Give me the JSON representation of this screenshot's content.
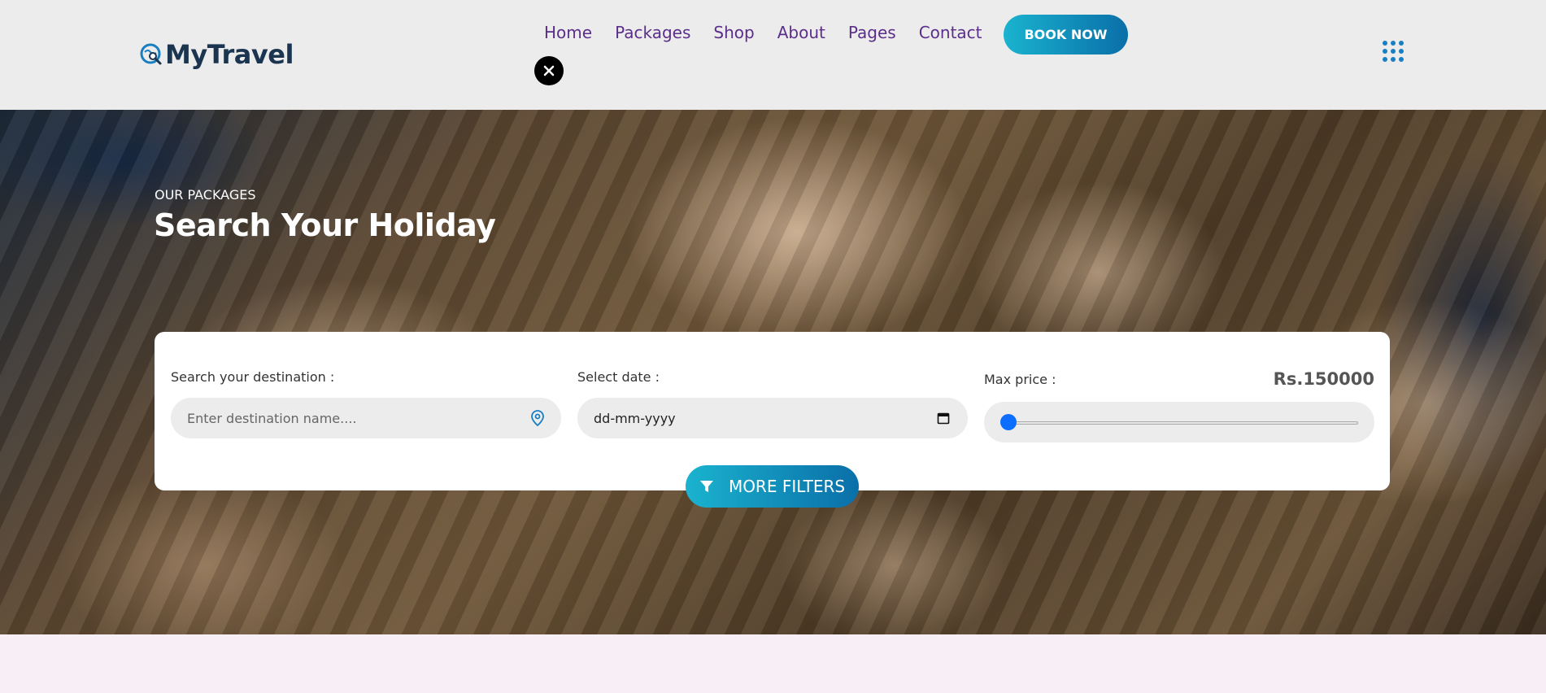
{
  "header": {
    "logo_text": "MyTravel",
    "nav": [
      "Home",
      "Packages",
      "Shop",
      "About",
      "Pages",
      "Contact"
    ],
    "book_label": "BOOK NOW"
  },
  "hero": {
    "eyebrow": "OUR PACKAGES",
    "title": "Search Your Holiday"
  },
  "search": {
    "destination_label": "Search your destination :",
    "destination_placeholder": "Enter destination name....",
    "date_label": "Select date :",
    "date_value": "dd-mm-yyyy",
    "price_label": "Max price :",
    "price_value": "Rs.150000",
    "price_slider_fraction": 0.0,
    "filters_label": "MORE FILTERS"
  },
  "colors": {
    "accent_start": "#1ab3cf",
    "accent_end": "#0a6fa8",
    "nav_text": "#5a2e8a",
    "logo_text": "#1b3550"
  },
  "icons": {
    "logo": "globe-search-icon",
    "close": "close-icon",
    "menu": "grid-dots-icon",
    "destination": "map-pin-icon",
    "date": "calendar-icon",
    "filters": "funnel-icon",
    "socials": [
      "facebook-icon",
      "instagram-icon",
      "tripadvisor-icon"
    ],
    "views": [
      "list-view-icon",
      "grid-view-icon"
    ]
  }
}
